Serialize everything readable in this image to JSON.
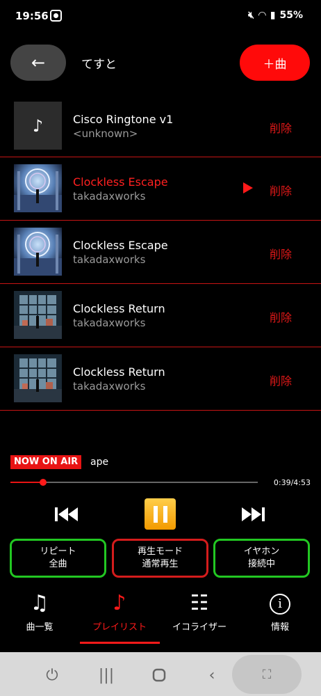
{
  "status_bar": {
    "time": "19:56",
    "battery": "55%",
    "icons": [
      "screenshot-icon",
      "mute-icon",
      "wifi-icon",
      "signal-icon"
    ]
  },
  "header": {
    "back_label": "←",
    "playlist_name": "てすと",
    "add_label": "＋曲"
  },
  "tracks": [
    {
      "title": "Cisco Ringtone v1",
      "artist": "<unknown>",
      "art": "note",
      "playing": false,
      "delete_label": "削除"
    },
    {
      "title": "Clockless Escape",
      "artist": "takadaxworks",
      "art": "escape",
      "playing": true,
      "delete_label": "削除"
    },
    {
      "title": "Clockless Escape",
      "artist": "takadaxworks",
      "art": "escape",
      "playing": false,
      "delete_label": "削除"
    },
    {
      "title": "Clockless Return",
      "artist": "takadaxworks",
      "art": "return",
      "playing": false,
      "delete_label": "削除"
    },
    {
      "title": "Clockless Return",
      "artist": "takadaxworks",
      "art": "return",
      "playing": false,
      "delete_label": "削除"
    }
  ],
  "now_playing": {
    "badge": "NOW ON AIR",
    "title": "ape",
    "time": "0:39/4:53",
    "progress": 0.133
  },
  "modes": {
    "repeat": {
      "line1": "リピート",
      "line2": "全曲"
    },
    "playback": {
      "line1": "再生モード",
      "line2": "通常再生"
    },
    "earphone": {
      "line1": "イヤホン",
      "line2": "接続中"
    }
  },
  "nav": {
    "songs": {
      "icon": "♫",
      "label": "曲一覧"
    },
    "playlist": {
      "icon": "♪",
      "label": "プレイリスト"
    },
    "equalizer": {
      "icon": "☷",
      "label": "イコライザー"
    },
    "info": {
      "icon": "i",
      "label": "情報"
    }
  },
  "colors": {
    "accent": "#ff1a1a",
    "green_border": "#22c722",
    "pause_gold": "#f2a800",
    "background": "#000000"
  }
}
